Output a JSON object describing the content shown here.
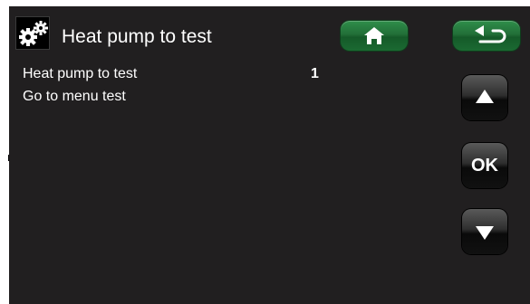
{
  "header": {
    "icon": "gears-icon",
    "title": "Heat pump to test"
  },
  "toolbar": {
    "home_icon": "home-icon",
    "back_icon": "back-arrow-icon",
    "accent_color": "#226f38"
  },
  "menu": {
    "rows": [
      {
        "label": "Heat pump to test",
        "value": "1"
      },
      {
        "label": "Go to menu test",
        "value": ""
      }
    ]
  },
  "navigation": {
    "up_icon": "triangle-up-icon",
    "ok_label": "OK",
    "down_icon": "triangle-down-icon"
  }
}
